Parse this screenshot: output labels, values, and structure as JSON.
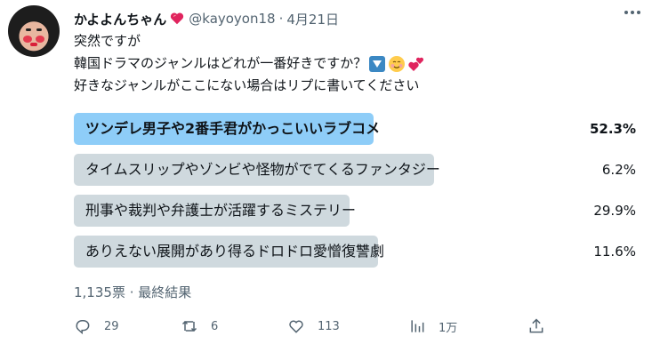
{
  "tweet": {
    "display_name": "かよよんちゃん",
    "handle": "@kayoyon18",
    "separator": "·",
    "date": "4月21日",
    "text_line1": "突然ですが",
    "text_line2": "韓国ドラマのジャンルはどれが一番好きですか？",
    "text_line3": "好きなジャンルがここにない場合はリプに書いてください"
  },
  "poll": {
    "options": [
      {
        "label": "ツンデレ男子や2番手君がかっこいいラブコメ",
        "percent": "52.3%",
        "fraction": 0.523,
        "winner": true
      },
      {
        "label": "タイムスリップやゾンビや怪物がでてくるファンタジー",
        "percent": "6.2%",
        "fraction": 0.062,
        "winner": false
      },
      {
        "label": "刑事や裁判や弁護士が活躍するミステリー",
        "percent": "29.9%",
        "fraction": 0.299,
        "winner": false
      },
      {
        "label": "ありえない展開があり得るドロドロ愛憎復讐劇",
        "percent": "11.6%",
        "fraction": 0.116,
        "winner": false
      }
    ],
    "votes_status": "1,135票 · 最終結果"
  },
  "actions": {
    "reply_count": "29",
    "retweet_count": "6",
    "like_count": "113",
    "views_count": "1万"
  },
  "colors": {
    "winner_bar": "#8ecdf8",
    "other_bar": "#cfd9de",
    "secondary_text": "#536471"
  },
  "icons": [
    "heart-emoji-icon",
    "more-icon",
    "down-arrow-emoji-icon",
    "smiling-face-emoji-icon",
    "two-hearts-emoji-icon",
    "reply-icon",
    "retweet-icon",
    "like-icon",
    "views-icon",
    "share-icon"
  ]
}
